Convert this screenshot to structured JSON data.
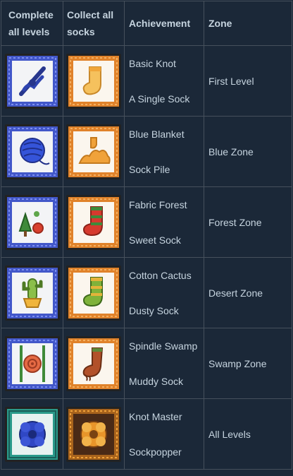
{
  "headers": {
    "levels": "Complete all levels",
    "socks": "Collect all socks",
    "achievement": "Achievement",
    "zone": "Zone"
  },
  "rows": [
    {
      "levels_icon": "knot-icon",
      "socks_icon": "single-sock-icon",
      "ach1": "Basic Knot",
      "ach2": "A Single Sock",
      "zone": "First Level"
    },
    {
      "levels_icon": "yarn-ball-icon",
      "socks_icon": "sock-pile-icon",
      "ach1": "Blue Blanket",
      "ach2": "Sock Pile",
      "zone": "Blue Zone"
    },
    {
      "levels_icon": "fabric-forest-icon",
      "socks_icon": "sweet-sock-icon",
      "ach1": "Fabric Forest",
      "ach2": "Sweet Sock",
      "zone": "Forest Zone"
    },
    {
      "levels_icon": "cactus-icon",
      "socks_icon": "dusty-sock-icon",
      "ach1": "Cotton Cactus",
      "ach2": "Dusty Sock",
      "zone": "Desert Zone"
    },
    {
      "levels_icon": "spindle-icon",
      "socks_icon": "muddy-sock-icon",
      "ach1": "Spindle Swamp",
      "ach2": "Muddy Sock",
      "zone": "Swamp Zone"
    },
    {
      "levels_icon": "blue-flower-knot-icon",
      "socks_icon": "gold-flower-icon",
      "ach1": "Knot Master",
      "ach2": "Sockpopper",
      "zone": "All Levels"
    }
  ],
  "colors": {
    "background": "#1b2838",
    "grid": "#46505c",
    "text": "#c6d4df",
    "blue_frame": "#3b4fc0",
    "orange_frame": "#e0822a"
  }
}
